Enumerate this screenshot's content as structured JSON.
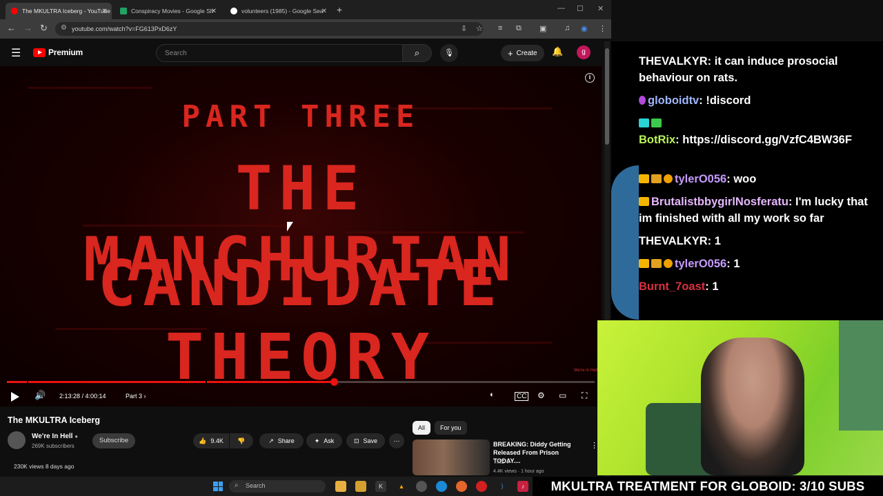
{
  "browser": {
    "tabs": [
      {
        "title": "The MKULTRA Iceberg - YouTube",
        "active": true,
        "favicon_color": "#ff0000"
      },
      {
        "title": "Conspiracy Movies - Google Sh",
        "active": false,
        "favicon_color": "#1ea362"
      },
      {
        "title": "volunteers (1985) - Google Sea",
        "active": false,
        "favicon_color": "#ffffff"
      }
    ],
    "url": "youtube.com/watch?v=FG613PxD6zY"
  },
  "youtube": {
    "logo_text": "Premium",
    "search_placeholder": "Search",
    "create_label": "Create",
    "avatar_letter": "g"
  },
  "video": {
    "title_part": "PART THREE",
    "title_line1": "THE MANCHURIAN",
    "title_line2": "CANDIDATE THEORY",
    "watermark": "We're In Hell",
    "time": "2:13:28 / 4:00:14",
    "chapter": "Part 3 ›",
    "progress_fraction": 0.5558,
    "chapter_breaks": [
      0.034,
      0.338
    ]
  },
  "below": {
    "video_title": "The MKULTRA Iceberg",
    "channel_name": "We're In Hell",
    "channel_subs": "269K subscribers",
    "subscribe_label": "Subscribe",
    "likes": "9.4K",
    "share_label": "Share",
    "ask_label": "Ask",
    "save_label": "Save",
    "views": "230K views  8 days ago",
    "filters": [
      "All",
      "For you"
    ],
    "rec": {
      "title": "BREAKING: Diddy Getting Released From Prison TODAY....",
      "channel": "TMZ",
      "meta": "4.4K views · 1 hour ago"
    }
  },
  "chat": [
    {
      "user": "THEVALKYR",
      "user_color": "#ffffff",
      "text": "it can induce prosocial behaviour on rats."
    },
    {
      "user": "globoidtv",
      "user_color": "#9fb6ff",
      "text": "!discord"
    },
    {
      "user": "BotRix",
      "user_color": "#b9f35a",
      "text": "https://discord.gg/VzfC4BW36F"
    },
    {
      "user": "tylerO056",
      "user_color": "#c79bff",
      "text": "woo"
    },
    {
      "user": "BrutalistbbygirlNosferatu",
      "user_color": "#e7b8ff",
      "text": "I'm lucky that im finished with all my work so far"
    },
    {
      "user": "THEVALKYR",
      "user_color": "#ffffff",
      "text": "1"
    },
    {
      "user": "tylerO056",
      "user_color": "#c79bff",
      "text": "1"
    },
    {
      "user": "Burnt_7oast",
      "user_color": "#d9303f",
      "text": "1"
    }
  ],
  "taskbar": {
    "search_label": "Search"
  },
  "ticker": "MKULTRA TREATMENT FOR GLOBOID: 3/10 SUBS",
  "colors": {
    "accent": "#ff0000",
    "video_title": "#d9261f",
    "webcam_bg": "#b8e830"
  }
}
